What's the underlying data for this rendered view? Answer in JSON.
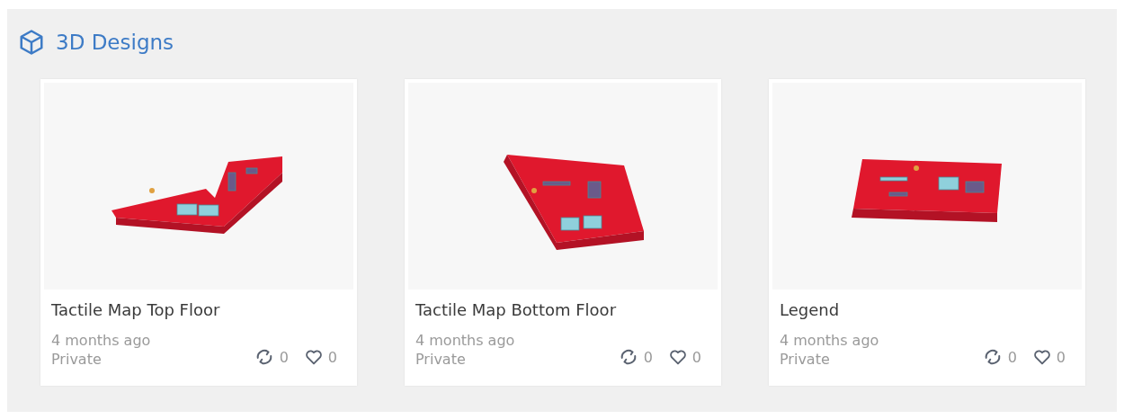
{
  "section": {
    "title": "3D Designs"
  },
  "designs": [
    {
      "name": "Tactile Map Top Floor",
      "modified": "4 months ago",
      "visibility": "Private",
      "copies": "0",
      "likes": "0"
    },
    {
      "name": "Tactile Map Bottom Floor",
      "modified": "4 months ago",
      "visibility": "Private",
      "copies": "0",
      "likes": "0"
    },
    {
      "name": "Legend",
      "modified": "4 months ago",
      "visibility": "Private",
      "copies": "0",
      "likes": "0"
    }
  ]
}
